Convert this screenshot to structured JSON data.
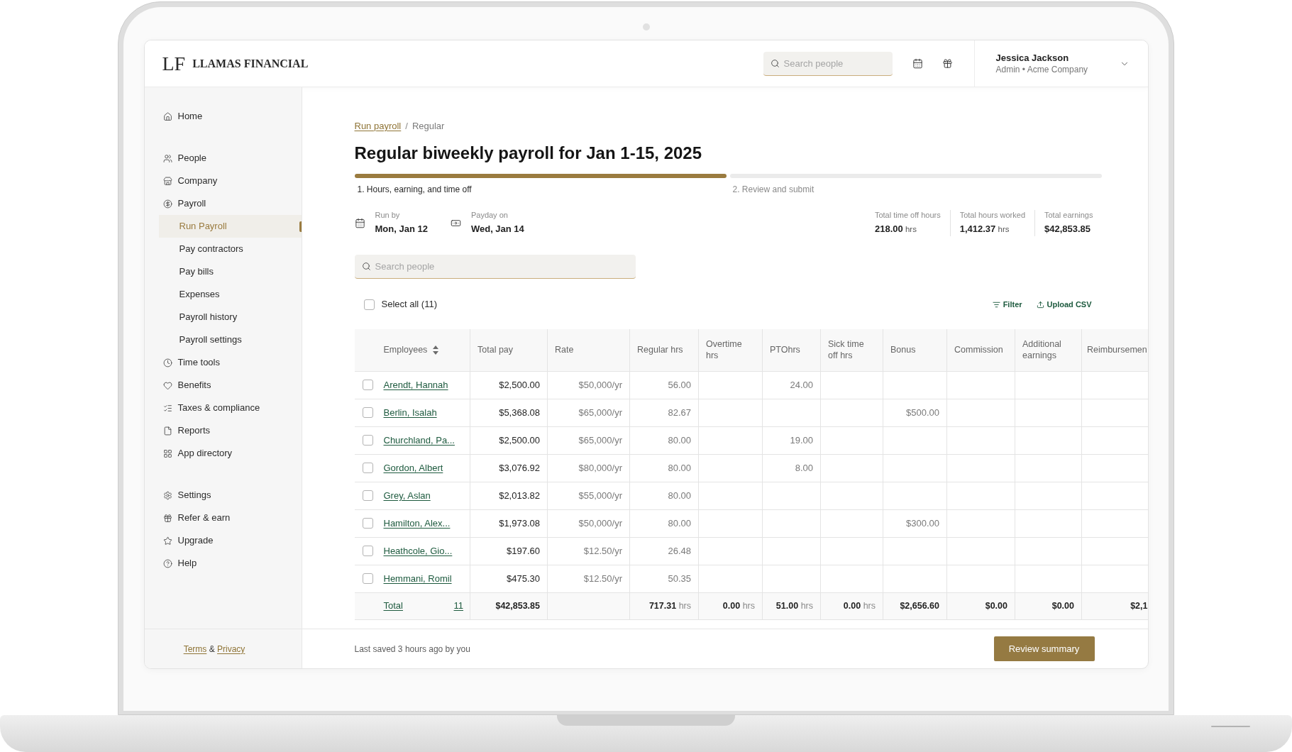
{
  "header": {
    "logo_mark": "LF",
    "brand": "LLAMAS FINANCIAL",
    "search": {
      "placeholder": "Search people"
    },
    "user": {
      "name": "Jessica Jackson",
      "role": "Admin • Acme Company"
    }
  },
  "sidebar": {
    "sections": [
      {
        "items": [
          {
            "label": "Home",
            "selected": false
          }
        ]
      },
      {
        "items": [
          {
            "label": "People",
            "selected": false
          },
          {
            "label": "Company",
            "selected": false
          },
          {
            "label": "Payroll",
            "selected": false,
            "children": [
              {
                "label": "Run Payroll",
                "selected": true
              },
              {
                "label": "Pay contractors",
                "selected": false
              },
              {
                "label": "Pay bills",
                "selected": false
              },
              {
                "label": "Expenses",
                "selected": false
              },
              {
                "label": "Payroll history",
                "selected": false
              },
              {
                "label": "Payroll settings",
                "selected": false
              }
            ]
          },
          {
            "label": "Time tools",
            "selected": false
          },
          {
            "label": "Benefits",
            "selected": false
          },
          {
            "label": "Taxes & compliance",
            "selected": false
          },
          {
            "label": "Reports",
            "selected": false
          },
          {
            "label": "App directory",
            "selected": false
          }
        ]
      },
      {
        "items": [
          {
            "label": "Settings",
            "selected": false
          },
          {
            "label": "Refer & earn",
            "selected": false
          },
          {
            "label": "Upgrade",
            "selected": false
          },
          {
            "label": "Help",
            "selected": false
          }
        ]
      }
    ],
    "legal": {
      "terms": "Terms",
      "joiner": "&",
      "privacy": "Privacy"
    }
  },
  "main": {
    "breadcrumb": {
      "items": [
        {
          "label": "Run payroll",
          "kind": "link"
        },
        {
          "label": "Regular",
          "kind": "current"
        }
      ],
      "separator": "/"
    },
    "title": "Regular biweekly payroll for Jan 1-15, 2025",
    "steps": [
      {
        "label": "1. Hours, earning, and time off",
        "selected": true
      },
      {
        "label": "2. Review and submit",
        "selected": false
      }
    ],
    "dates": [
      {
        "label": "Run by",
        "value": "Mon, Jan 12"
      },
      {
        "label": "Payday on",
        "value": "Wed, Jan 14"
      }
    ],
    "totals": [
      {
        "label": "Total time off hours",
        "value": "218.00",
        "unit": "hrs"
      },
      {
        "label": "Total hours worked",
        "value": "1,412.37",
        "unit": "hrs"
      },
      {
        "label": "Total earnings",
        "value": "$42,853.85"
      }
    ],
    "search": {
      "placeholder": "Search people"
    },
    "select_all": {
      "label": "Select all (11)",
      "checked": false
    },
    "actions": [
      {
        "label": "Filter"
      },
      {
        "label": "Upload CSV"
      }
    ],
    "table": {
      "columns": [
        {
          "label": "Employees",
          "sortable": true
        },
        {
          "label": "Total pay",
          "sortable": false
        },
        {
          "label": "Rate",
          "sortable": false
        },
        {
          "label": "Regular hrs",
          "sortable": false
        },
        {
          "label": "Overtime hrs",
          "sortable": false
        },
        {
          "label": "PTOhrs",
          "sortable": false
        },
        {
          "label": "Sick time off hrs",
          "sortable": false
        },
        {
          "label": "Bonus",
          "sortable": false
        },
        {
          "label": "Commission",
          "sortable": false
        },
        {
          "label": "Additional earnings",
          "sortable": false
        },
        {
          "label": "Reimbursemen",
          "sortable": false
        }
      ],
      "rows": [
        {
          "checked": false,
          "cells": [
            "Arendt, Hannah",
            "$2,500.00",
            "$50,000/yr",
            "56.00",
            null,
            "24.00",
            null,
            null,
            null,
            null,
            null
          ]
        },
        {
          "checked": false,
          "cells": [
            "Berlin, Isalah",
            "$5,368.08",
            "$65,000/yr",
            "82.67",
            null,
            null,
            null,
            "$500.00",
            null,
            null,
            null
          ]
        },
        {
          "checked": false,
          "cells": [
            "Churchland, Pa...",
            "$2,500.00",
            "$65,000/yr",
            "80.00",
            null,
            "19.00",
            null,
            null,
            null,
            null,
            null
          ]
        },
        {
          "checked": false,
          "cells": [
            "Gordon, Albert",
            "$3,076.92",
            "$80,000/yr",
            "80.00",
            null,
            "8.00",
            null,
            null,
            null,
            null,
            null
          ]
        },
        {
          "checked": false,
          "cells": [
            "Grey, Aslan",
            "$2,013.82",
            "$55,000/yr",
            "80.00",
            null,
            null,
            null,
            null,
            null,
            null,
            null
          ]
        },
        {
          "checked": false,
          "cells": [
            "Hamilton, Alex...",
            "$1,973.08",
            "$50,000/yr",
            "80.00",
            null,
            null,
            null,
            "$300.00",
            null,
            null,
            null
          ]
        },
        {
          "checked": false,
          "cells": [
            "Heathcole, Gio...",
            "$197.60",
            "$12.50/yr",
            "26.48",
            null,
            null,
            null,
            null,
            null,
            null,
            null
          ]
        },
        {
          "checked": false,
          "cells": [
            "Hemmani, Romil",
            "$475.30",
            "$12.50/yr",
            "50.35",
            null,
            null,
            null,
            null,
            null,
            null,
            null
          ]
        }
      ],
      "total": {
        "cells": [
          {
            "value": "Total",
            "count": "11"
          },
          {
            "value": "$42,853.85"
          },
          null,
          {
            "value": "717.31",
            "unit": "hrs"
          },
          {
            "value": "0.00",
            "unit": "hrs"
          },
          {
            "value": "51.00",
            "unit": "hrs"
          },
          {
            "value": "0.00",
            "unit": "hrs"
          },
          {
            "value": "$2,656.60"
          },
          {
            "value": "$0.00"
          },
          {
            "value": "$0.00"
          },
          {
            "value": "$2,1"
          }
        ]
      }
    },
    "footer": {
      "status": "Last saved 3 hours ago by you",
      "button": "Review summary"
    }
  }
}
